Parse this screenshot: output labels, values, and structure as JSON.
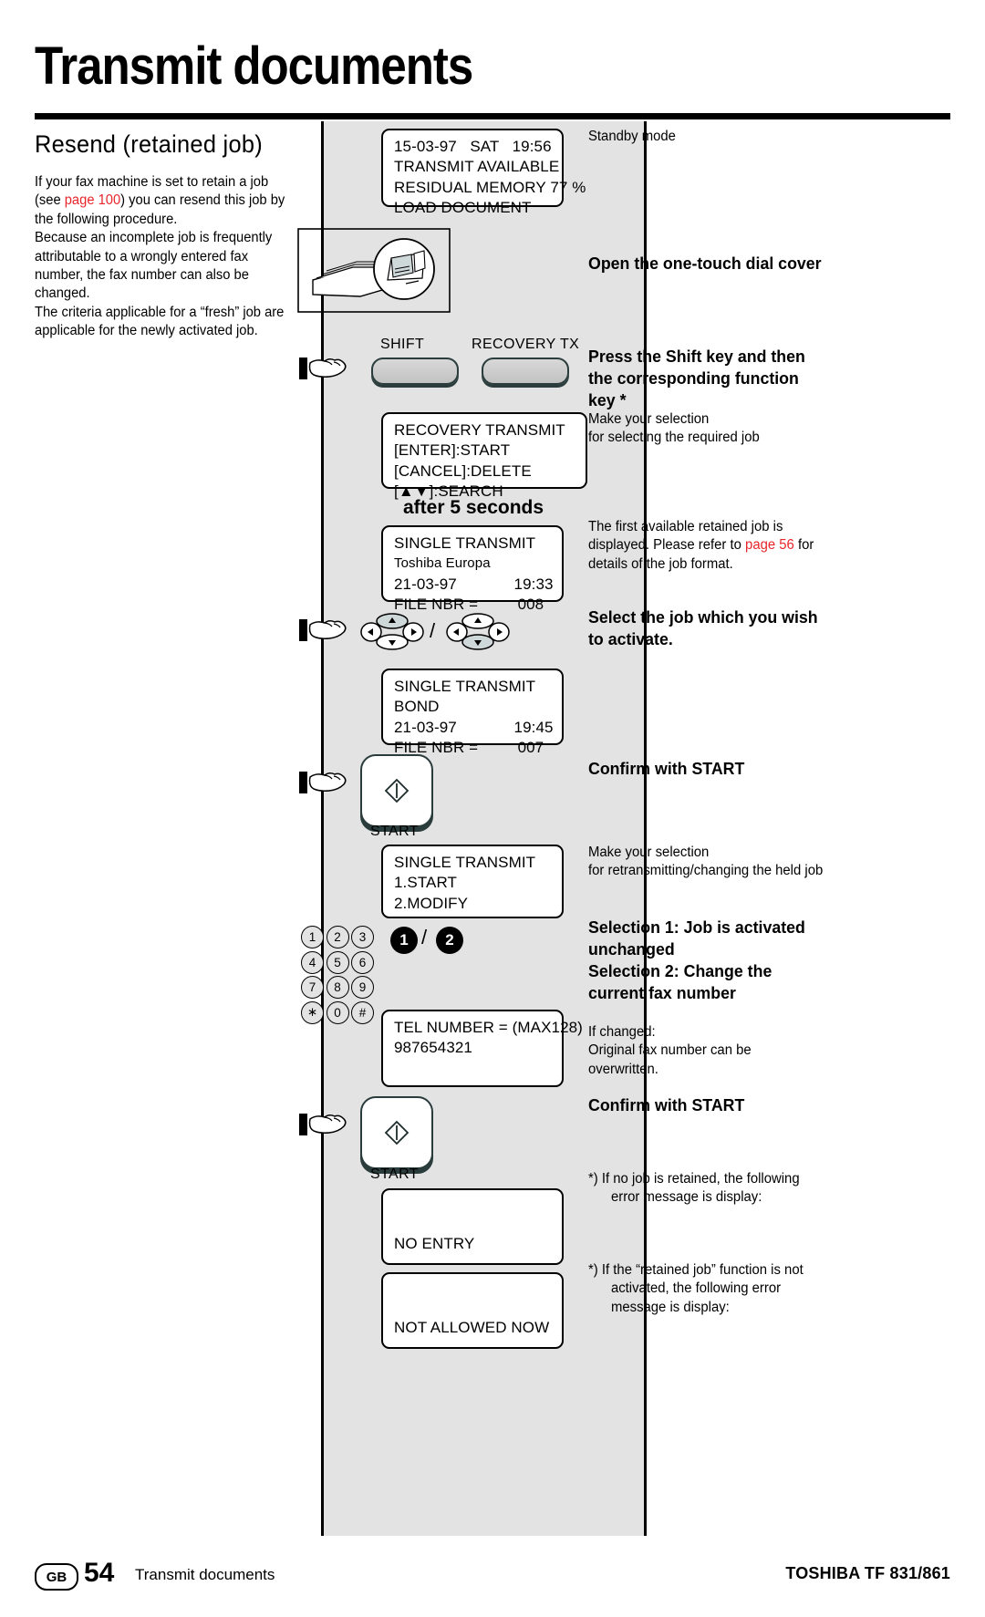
{
  "header": {
    "title": "Transmit documents"
  },
  "left": {
    "section_title": "Resend (retained job)",
    "para1_a": "If your fax machine is set to retain a job (see ",
    "para1_link": "page 100",
    "para1_b": ") you can resend this job by the following procedure.",
    "para2": "Because an incomplete job is frequently attributable to a wrongly entered fax number, the fax number can also be changed.",
    "para3": "The criteria applicable for a “fresh” job are applicable for the newly activated job."
  },
  "displays": {
    "standby": {
      "line1": "15-03-97   SAT   19:56",
      "line2": "TRANSMIT AVAILABLE",
      "line3": "RESIDUAL MEMORY 77 %",
      "line4": "LOAD DOCUMENT"
    },
    "recovery": {
      "line1": "RECOVERY TRANSMIT",
      "line2": "[ENTER]:START",
      "line3": "[CANCEL]:DELETE",
      "line4": "[▲▼]:SEARCH"
    },
    "job1": {
      "line1": "SINGLE TRANSMIT",
      "line2": "Toshiba Europa",
      "line3": "21-03-97             19:33",
      "line4": "FILE NBR =         008"
    },
    "job2": {
      "line1": "SINGLE TRANSMIT",
      "line2": "BOND",
      "line3": "21-03-97             19:45",
      "line4": "FILE NBR =         007"
    },
    "menu": {
      "line1": "SINGLE TRANSMIT",
      "line2": "1.START",
      "line3": "2.MODIFY"
    },
    "telnumber": {
      "line1": "TEL NUMBER = (MAX128)",
      "line2": "987654321"
    },
    "noentry": {
      "line1": "NO ENTRY"
    },
    "notallowed": {
      "line1": "NOT ALLOWED NOW"
    }
  },
  "keys": {
    "shift": "SHIFT",
    "recovery_tx": "RECOVERY TX",
    "start1": "START",
    "start2": "START",
    "after5": "after 5 seconds",
    "digit1": "1",
    "digit2": "2",
    "slash": "/",
    "keypad_rows": [
      [
        "1",
        "2",
        "3"
      ],
      [
        "4",
        "5",
        "6"
      ],
      [
        "7",
        "8",
        "9"
      ],
      [
        "∗",
        "0",
        "#"
      ]
    ]
  },
  "right": {
    "standby_mode": "Standby mode",
    "open_cover": "Open the one-touch dial cover",
    "press_shift": "Press the Shift key and then the corresponding function key *",
    "make_selection_1": "Make your selection\nfor selecting the required job",
    "first_job_a": "The first available retained job is displayed.\nPlease refer to ",
    "first_job_link": "page 56",
    "first_job_b": " for details of the job format.",
    "select_job": "Select the job which you wish to activate.",
    "confirm_start_1": "Confirm with START",
    "make_selection_2": "Make your selection\nfor retransmitting/changing the held job",
    "selection_12": "Selection 1: Job is activated unchanged\nSelection 2: Change the current fax number",
    "if_changed": "If changed:\nOriginal fax number can be overwritten.",
    "confirm_start_2": "Confirm with START",
    "note1": "*)  If no job is retained, the following error message is display:",
    "note2": "*)  If the “retained job” function is not activated, the following error message is display:"
  },
  "footer": {
    "locale": "GB",
    "page": "54",
    "section": "Transmit documents",
    "brand": "TOSHIBA  TF 831/861"
  },
  "colors": {
    "link_red": "#e8252a",
    "band_grey": "#e3e3e3",
    "key_dark": "#2a3c3c"
  }
}
